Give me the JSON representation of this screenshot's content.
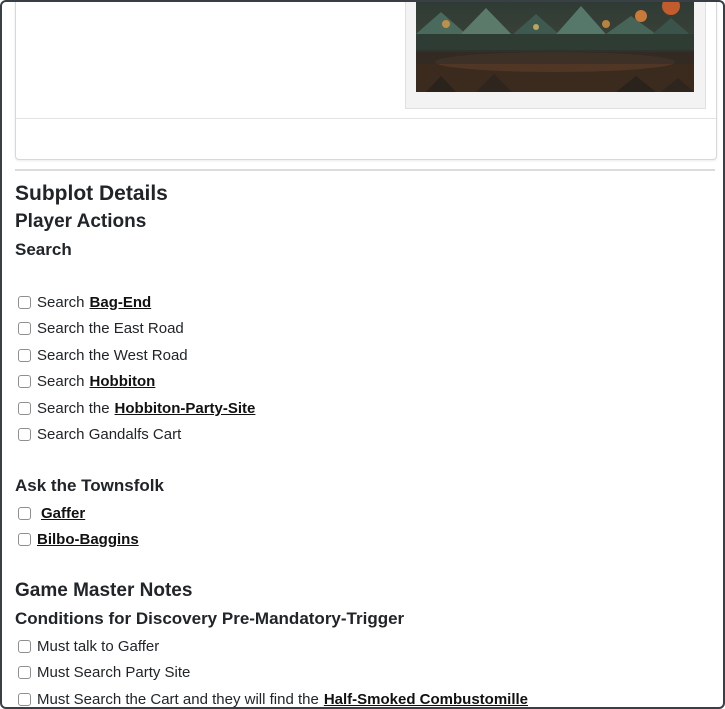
{
  "image": {
    "alt": "Bilbo's farewell party at Hobbiton",
    "colors": {
      "sky": "#2e3a36",
      "fire": "#e8642a",
      "ground": "#3b2a1e",
      "tents": "#4a6a5e"
    }
  },
  "subplot": {
    "title": "Subplot Details"
  },
  "player_actions": {
    "title": "Player Actions",
    "search": {
      "title": "Search",
      "items": [
        {
          "text": "Search",
          "link": "Bag-End"
        },
        {
          "text": "Search the East Road",
          "link": ""
        },
        {
          "text": "Search the West Road",
          "link": ""
        },
        {
          "text": "Search",
          "link": "Hobbiton"
        },
        {
          "text": "Search the",
          "link": "Hobbiton-Party-Site"
        },
        {
          "text": "Search Gandalfs Cart",
          "link": ""
        }
      ]
    },
    "townsfolk": {
      "title": "Ask the Townsfolk",
      "items": [
        {
          "link": "Gaffer"
        },
        {
          "link": "Bilbo-Baggins"
        }
      ]
    }
  },
  "gm_notes": {
    "title": "Game Master Notes",
    "conditions": {
      "title": "Conditions for Discovery Pre-Mandatory-Trigger",
      "items": [
        {
          "text": "Must talk to Gaffer",
          "link": ""
        },
        {
          "text": "Must Search Party Site",
          "link": ""
        },
        {
          "text": "Must Search the Cart and they will find the",
          "link": "Half-Smoked Combustomille"
        }
      ]
    }
  }
}
